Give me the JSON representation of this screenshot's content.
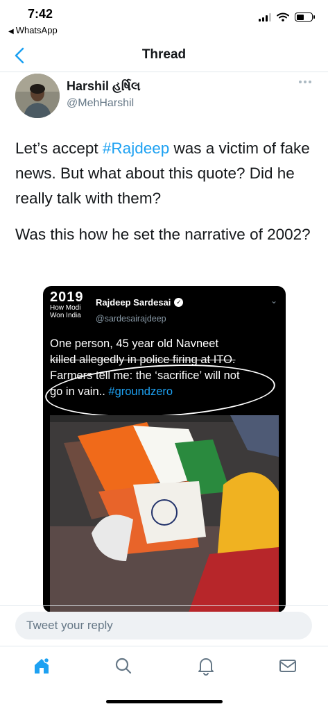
{
  "status_bar": {
    "time": "7:42",
    "back_app": "WhatsApp",
    "battery_level": 0.5
  },
  "nav": {
    "title": "Thread",
    "back_icon": "chevron-left-icon"
  },
  "tweet": {
    "author_name": "Harshil હર્ષિલ",
    "author_handle": "@MehHarshil",
    "paragraph1": {
      "before": "Let’s accept ",
      "hashtag": "#Rajdeep",
      "after": " was a victim of fake news. But what about this quote? Did he really talk with them?"
    },
    "paragraph2": "Was this how he set the narrative of 2002?"
  },
  "embedded_tweet": {
    "avatar_year": "2019",
    "avatar_line1": "How Modi",
    "avatar_line2": "Won India",
    "author_name": "Rajdeep Sardesai",
    "author_handle": "@sardesairajdeep",
    "line_a": "One person, 45 year old Navneet",
    "line_b": "killed allegedly in police firing at ITO.",
    "line_c": "Farmers tell me: the ‘sacrifice’ will not",
    "line_d": "go in vain.. ",
    "hashtag": "#groundzero"
  },
  "reply": {
    "placeholder": "Tweet your reply"
  },
  "tabs": [
    {
      "name": "home",
      "icon": "home-icon"
    },
    {
      "name": "search",
      "icon": "search-icon"
    },
    {
      "name": "notifications",
      "icon": "bell-icon"
    },
    {
      "name": "messages",
      "icon": "mail-icon"
    }
  ],
  "colors": {
    "accent": "#1da1f2",
    "text": "#14171a",
    "secondary": "#657786"
  }
}
